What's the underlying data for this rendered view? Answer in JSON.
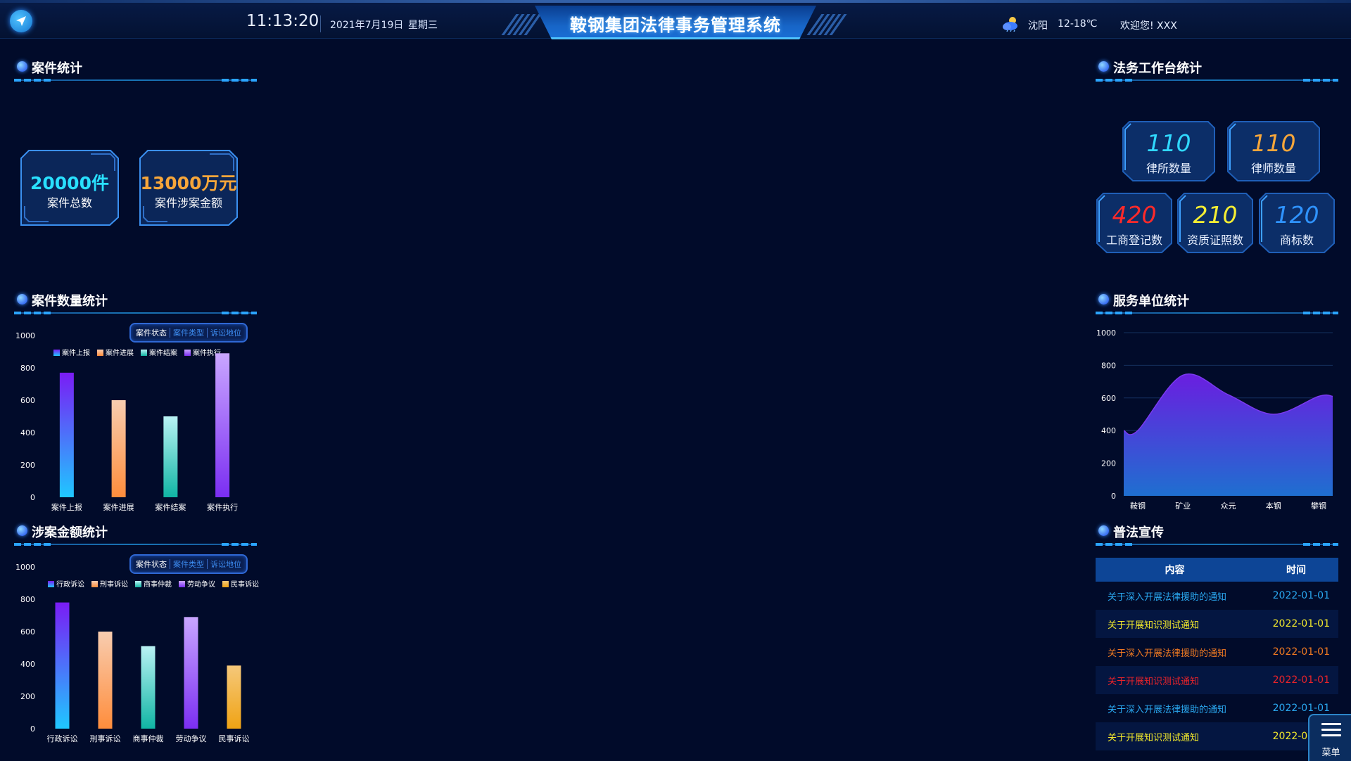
{
  "header": {
    "time": "11:13:20",
    "date": "2021年7月19日",
    "weekday": "星期三",
    "title": "鞍钢集团法律事务管理系统",
    "city": "沈阳",
    "temperature": "12-18℃",
    "welcome": "欢迎您! XXX"
  },
  "case_stats": {
    "title": "案件统计",
    "cards": [
      {
        "value": "20000件",
        "label": "案件总数",
        "color": "#29e0ff"
      },
      {
        "value": "13000万元",
        "label": "案件涉案金额",
        "color": "#f7a63a"
      }
    ]
  },
  "legal_stats": {
    "title": "法务工作台统计",
    "items": [
      {
        "value": "110",
        "label": "律所数量",
        "color": "#30d8ff"
      },
      {
        "value": "110",
        "label": "律师数量",
        "color": "#f7a63a"
      },
      {
        "value": "420",
        "label": "工商登记数",
        "color": "#ff2a2a"
      },
      {
        "value": "210",
        "label": "资质证照数",
        "color": "#f5ee33"
      },
      {
        "value": "120",
        "label": "商标数",
        "color": "#2f93ff"
      }
    ]
  },
  "case_count": {
    "title": "案件数量统计",
    "tabs": [
      "案件状态",
      "案件类型",
      "诉讼地位"
    ],
    "active_tab": 0
  },
  "case_amount": {
    "title": "涉案金额统计",
    "tabs": [
      "案件状态",
      "案件类型",
      "诉讼地位"
    ],
    "active_tab": 0
  },
  "service_units": {
    "title": "服务单位统计"
  },
  "propaganda": {
    "title": "普法宣传",
    "headers": [
      "内容",
      "时间"
    ],
    "rows": [
      {
        "content": "关于深入开展法律援助的通知",
        "time": "2022-01-01",
        "color": "#2aa8f0"
      },
      {
        "content": "关于开展知识测试通知",
        "time": "2022-01-01",
        "color": "#f2e92c"
      },
      {
        "content": "关于深入开展法律援助的通知",
        "time": "2022-01-01",
        "color": "#f07a22"
      },
      {
        "content": "关于开展知识测试通知",
        "time": "2022-01-01",
        "color": "#e8232a"
      },
      {
        "content": "关于深入开展法律援助的通知",
        "time": "2022-01-01",
        "color": "#2aa8f0"
      },
      {
        "content": "关于开展知识测试通知",
        "time": "2022-01-01",
        "color": "#f2e92c"
      }
    ]
  },
  "menu": {
    "label": "菜单"
  },
  "chart_data": [
    {
      "type": "bar",
      "ylim": [
        0,
        1000
      ],
      "yticks": [
        0,
        200,
        400,
        600,
        800,
        1000
      ],
      "categories": [
        "案件上报",
        "案件进展",
        "案件结案",
        "案件执行"
      ],
      "legend": [
        "案件上报",
        "案件进展",
        "案件结案",
        "案件执行"
      ],
      "values": [
        770,
        600,
        500,
        890
      ],
      "gradients": [
        [
          "#7a1cf5",
          "#1fc8ff"
        ],
        [
          "#f8cdb0",
          "#ff8d3c"
        ],
        [
          "#b9f2f4",
          "#10b5a4"
        ],
        [
          "#c9a6ff",
          "#7b2ef2"
        ]
      ]
    },
    {
      "type": "bar",
      "ylim": [
        0,
        1000
      ],
      "yticks": [
        0,
        200,
        400,
        600,
        800,
        1000
      ],
      "categories": [
        "行政诉讼",
        "刑事诉讼",
        "商事仲裁",
        "劳动争议",
        "民事诉讼"
      ],
      "legend": [
        "行政诉讼",
        "刑事诉讼",
        "商事仲裁",
        "劳动争议",
        "民事诉讼"
      ],
      "values": [
        780,
        600,
        510,
        690,
        390
      ],
      "gradients": [
        [
          "#7a1cf5",
          "#1fc8ff"
        ],
        [
          "#f8cdb0",
          "#ff8d3c"
        ],
        [
          "#b9f2f4",
          "#10b5a4"
        ],
        [
          "#c9a6ff",
          "#7b2ef2"
        ],
        [
          "#f5c87a",
          "#f0a314"
        ]
      ]
    },
    {
      "type": "area",
      "ylim": [
        0,
        1000
      ],
      "yticks": [
        0,
        200,
        400,
        600,
        800,
        1000
      ],
      "categories": [
        "鞍钢",
        "矿业",
        "众元",
        "本钢",
        "攀钢"
      ],
      "values": [
        400,
        740,
        620,
        500,
        610
      ]
    }
  ]
}
